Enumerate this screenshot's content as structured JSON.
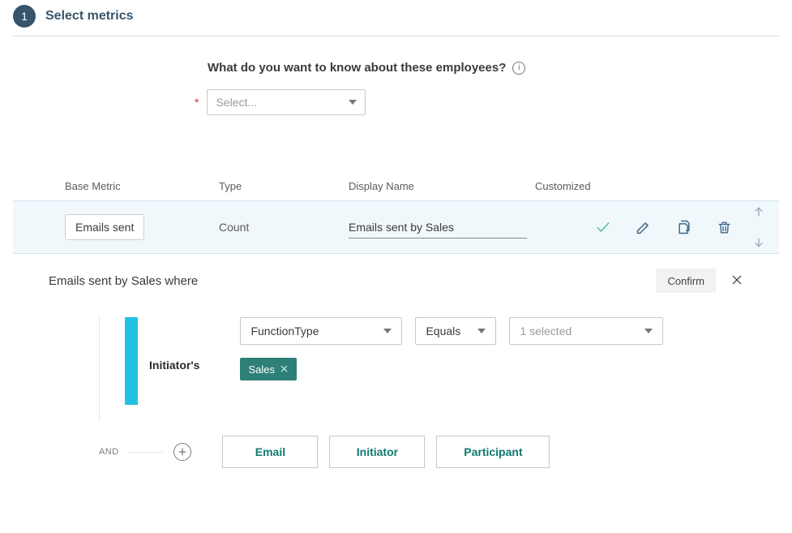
{
  "step": {
    "number": "1",
    "title": "Select metrics"
  },
  "prompt": {
    "question": "What do you want to know about these employees?",
    "select_placeholder": "Select..."
  },
  "table": {
    "headers": {
      "base": "Base Metric",
      "type": "Type",
      "display": "Display Name",
      "customized": "Customized"
    },
    "row": {
      "base_metric": "Emails sent",
      "type": "Count",
      "display_name": "Emails sent by Sales"
    }
  },
  "editor": {
    "title": "Emails sent by Sales where",
    "confirm_label": "Confirm",
    "initiator_label": "Initiator's",
    "attribute_dd": "FunctionType",
    "operator_dd": "Equals",
    "value_dd": "1 selected",
    "tag": "Sales",
    "and_label": "AND",
    "group_buttons": {
      "email": "Email",
      "initiator": "Initiator",
      "participant": "Participant"
    }
  }
}
